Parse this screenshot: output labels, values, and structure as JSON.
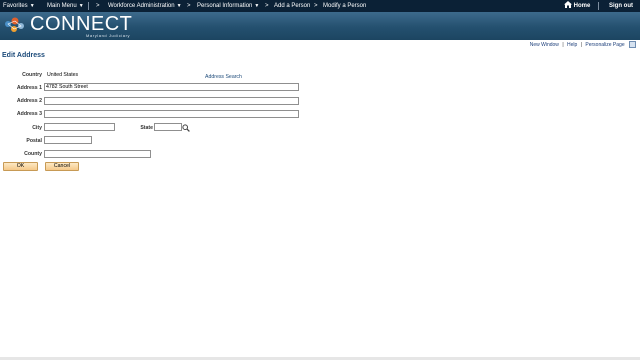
{
  "topnav": {
    "favorites": "Favorites",
    "main_menu": "Main Menu",
    "sep": ">",
    "workforce_admin": "Workforce Administration",
    "personal_info": "Personal Information",
    "add_person": "Add a Person",
    "modify_person": "Modify a Person",
    "home": "Home",
    "sign_out": "Sign out"
  },
  "banner": {
    "logo_text": "CONNECT",
    "logo_sub": "Maryland Judiciary"
  },
  "utility": {
    "new_window": "New Window",
    "help": "Help",
    "personalize": "Personalize Page",
    "pipe": "|"
  },
  "page": {
    "title": "Edit Address"
  },
  "form": {
    "country_label": "Country",
    "country_value": "United States",
    "address_search": "Address Search",
    "address1_label": "Address 1",
    "address1_value": "4782 South Street",
    "address2_label": "Address 2",
    "address2_value": "",
    "address3_label": "Address 3",
    "address3_value": "",
    "city_label": "City",
    "city_value": "",
    "state_label": "State",
    "state_value": "",
    "postal_label": "Postal",
    "postal_value": "",
    "county_label": "County",
    "county_value": ""
  },
  "buttons": {
    "ok": "OK",
    "cancel": "Cancel"
  },
  "colors": {
    "nav_bg": "#0b2136",
    "banner_bg": "#24506f",
    "title": "#1d4b7a",
    "button": "#f6c98a"
  }
}
